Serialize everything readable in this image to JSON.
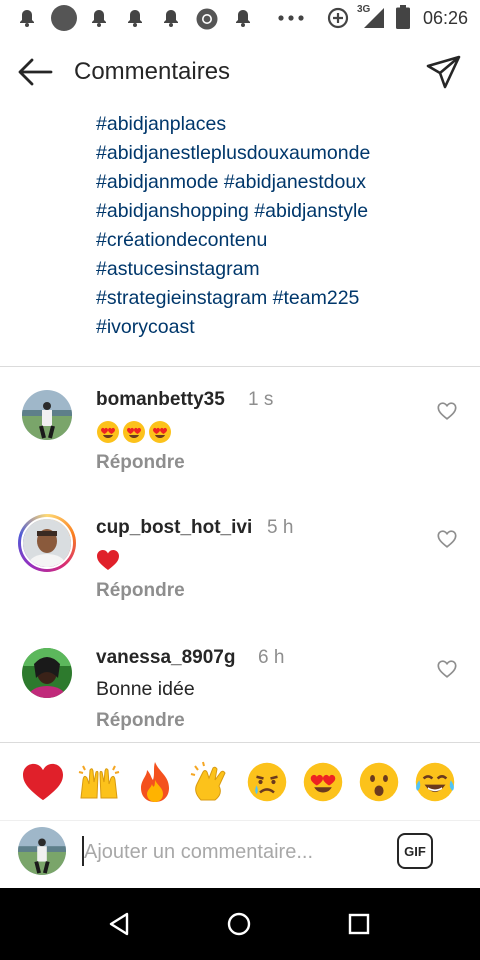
{
  "status_bar": {
    "time": "06:26",
    "network": "3G",
    "icons": [
      "notification-icon",
      "profile-circle-icon",
      "notification-icon",
      "notification-icon",
      "notification-icon",
      "chrome-icon",
      "notification-icon",
      "more-dots-icon",
      "data-saver-icon",
      "signal-icon",
      "battery-icon"
    ]
  },
  "header": {
    "title": "Commentaires",
    "back_icon": "arrow-left-icon",
    "send_icon": "direct-send-icon"
  },
  "caption": {
    "lines": [
      "#abidjanplaces",
      "#abidjanestleplusdouxaumonde",
      "#abidjanmode #abidjanestdoux",
      "#abidjanshopping #abidjanstyle",
      "#créationdecontenu",
      "#astucesinstagram",
      "#strategieinstagram #team225",
      "#ivorycoast"
    ]
  },
  "comments": [
    {
      "username": "bomanbetty35",
      "time": "1 s",
      "text": "",
      "emojis": [
        "heart-eyes",
        "heart-eyes",
        "heart-eyes"
      ],
      "reply_label": "Répondre",
      "has_story_ring": false
    },
    {
      "username": "cup_bost_hot_ivi",
      "time": "5 h",
      "text": "",
      "emojis": [
        "red-heart"
      ],
      "reply_label": "Répondre",
      "has_story_ring": true
    },
    {
      "username": "vanessa_8907g",
      "time": "6 h",
      "text": "Bonne idée",
      "emojis": [],
      "reply_label": "Répondre",
      "has_story_ring": false
    }
  ],
  "quick_emojis": [
    "red-heart",
    "raising-hands",
    "fire",
    "clapping-hands",
    "crying-face",
    "heart-eyes",
    "astonished-face",
    "tears-of-joy"
  ],
  "composer": {
    "placeholder": "Ajouter un commentaire...",
    "value": "",
    "gif_label": "GIF"
  },
  "colors": {
    "hashtag": "#00376b",
    "text": "#262626",
    "muted": "#8e8e8e",
    "divider": "#dbdbdb"
  }
}
